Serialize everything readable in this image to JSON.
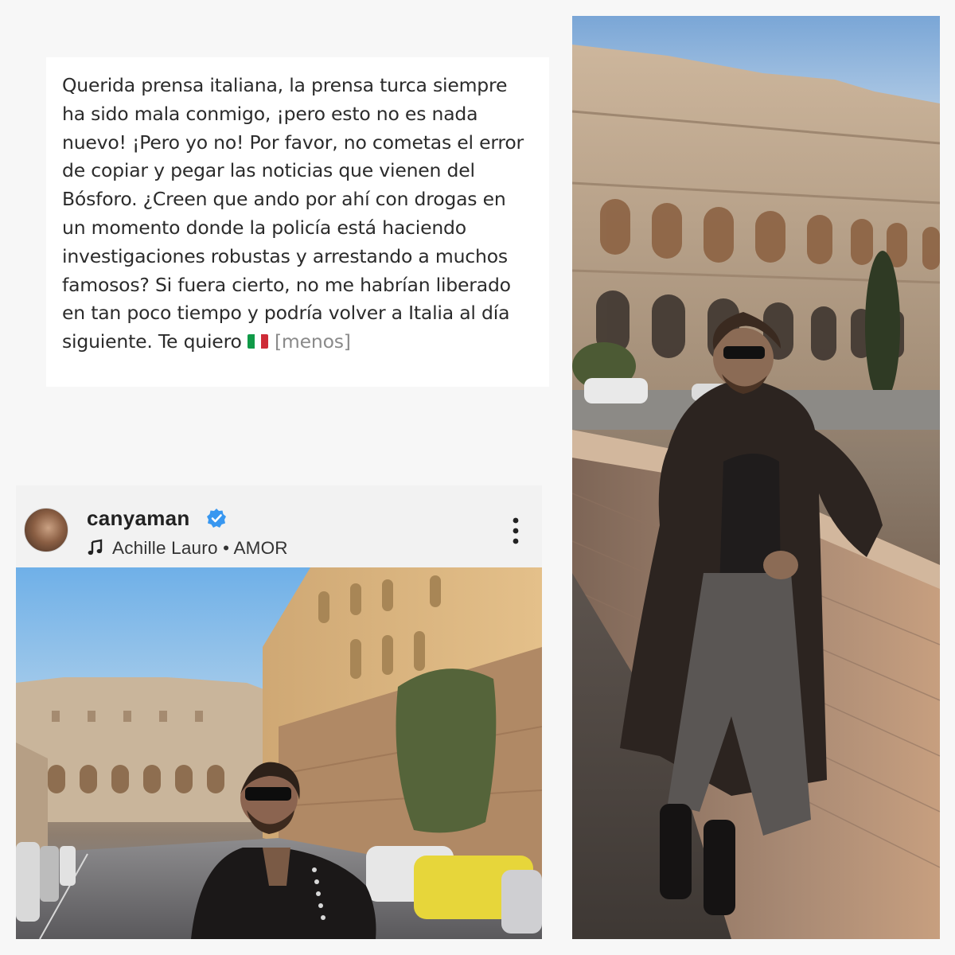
{
  "caption": {
    "text": "Querida prensa italiana, la prensa turca siempre ha sido mala conmigo, ¡pero esto no es nada nuevo! ¡Pero yo no! Por favor, no cometas el error de copiar y pegar las noticias que vienen del Bósforo. ¿Creen que ando por ahí con drogas en un momento donde la policía está haciendo investigaciones robustas y arrestando a muchos famosos? Si fuera cierto, no me habrían liberado en tan poco tiempo y podría volver a Italia al día siguiente. Te quiero",
    "less_label": "[menos]",
    "flag_colors": [
      "#109a48",
      "#ffffff",
      "#ce2b37"
    ]
  },
  "post": {
    "username": "canyaman",
    "verified": true,
    "music": {
      "icon": "music-note-icon",
      "artist": "Achille Lauro",
      "separator": " • ",
      "song": "AMOR"
    },
    "more_icon": "more-vertical-icon"
  },
  "colors": {
    "verified_blue": "#3897f0",
    "text_dark": "#2b2b2b",
    "link_grey": "#8a8a8a"
  }
}
